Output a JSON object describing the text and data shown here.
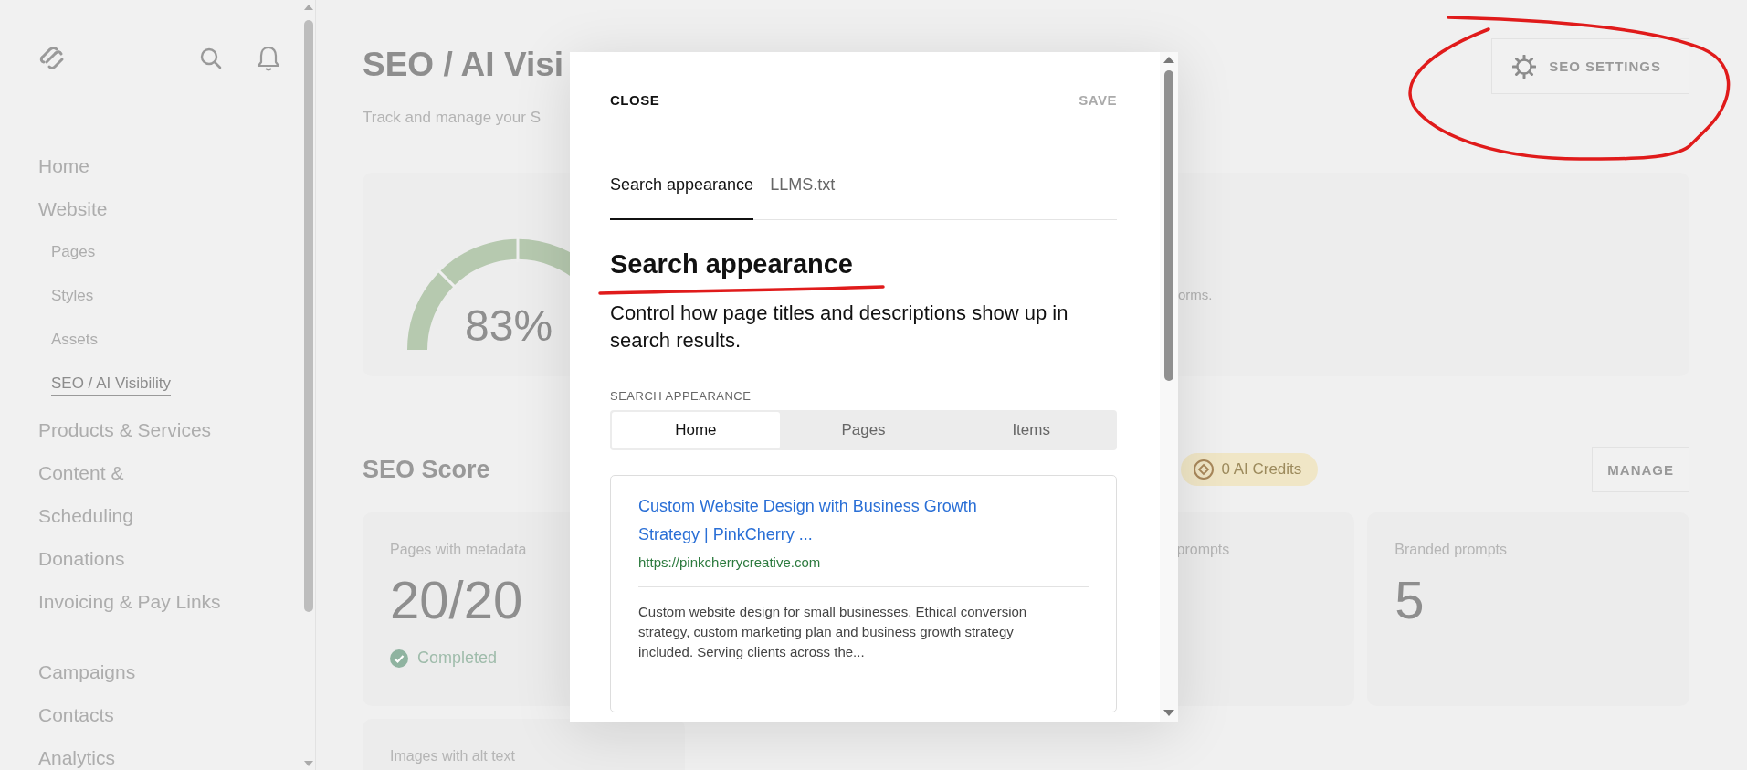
{
  "sidebar": {
    "nav": [
      {
        "label": "Home",
        "selected": false
      },
      {
        "label": "Website",
        "selected": false,
        "children": [
          {
            "label": "Pages",
            "selected": false
          },
          {
            "label": "Styles",
            "selected": false
          },
          {
            "label": "Assets",
            "selected": false
          },
          {
            "label": "SEO / AI Visibility",
            "selected": true
          }
        ]
      },
      {
        "label": "Products & Services",
        "selected": false
      },
      {
        "label": "Content &",
        "selected": false
      },
      {
        "label": "Scheduling",
        "selected": false
      },
      {
        "label": "Donations",
        "selected": false
      },
      {
        "label": "Invoicing & Pay Links",
        "selected": false
      }
    ],
    "nav_secondary": [
      {
        "label": "Campaigns",
        "selected": false
      },
      {
        "label": "Contacts",
        "selected": false
      },
      {
        "label": "Analytics",
        "selected": false
      }
    ]
  },
  "main": {
    "title": "SEO / AI Visi",
    "subtitle": "Track and manage your S",
    "settings_button": "SEO SETTINGS",
    "summary": {
      "gauge_label": "83%",
      "text": "orms."
    },
    "score": {
      "heading": "SEO Score",
      "credits": "0 AI Credits",
      "manage": "MANAGE"
    },
    "cards": [
      {
        "label": "Pages with metadata",
        "value": "20/20",
        "status": "Completed"
      },
      {
        "label": "prompts"
      },
      {
        "label": "Branded prompts",
        "value": "5"
      },
      {
        "label": "Images with alt text"
      }
    ]
  },
  "modal": {
    "close": "CLOSE",
    "save": "SAVE",
    "save_disabled": true,
    "tabs": [
      {
        "label": "Search appearance",
        "selected": true
      },
      {
        "label": "LLMS.txt",
        "selected": false
      }
    ],
    "heading": "Search appearance",
    "description": "Control how page titles and descriptions show up in search results.",
    "section_label": "SEARCH APPEARANCE",
    "segments": [
      {
        "label": "Home",
        "selected": true
      },
      {
        "label": "Pages",
        "selected": false
      },
      {
        "label": "Items",
        "selected": false
      }
    ],
    "preview": {
      "title": "Custom Website Design with Business Growth Strategy | PinkCherry ...",
      "url": "https://pinkcherrycreative.com",
      "description": "Custom website design for small businesses. Ethical conversion strategy, custom marketing plan and business growth strategy included. Serving clients across the..."
    }
  }
}
